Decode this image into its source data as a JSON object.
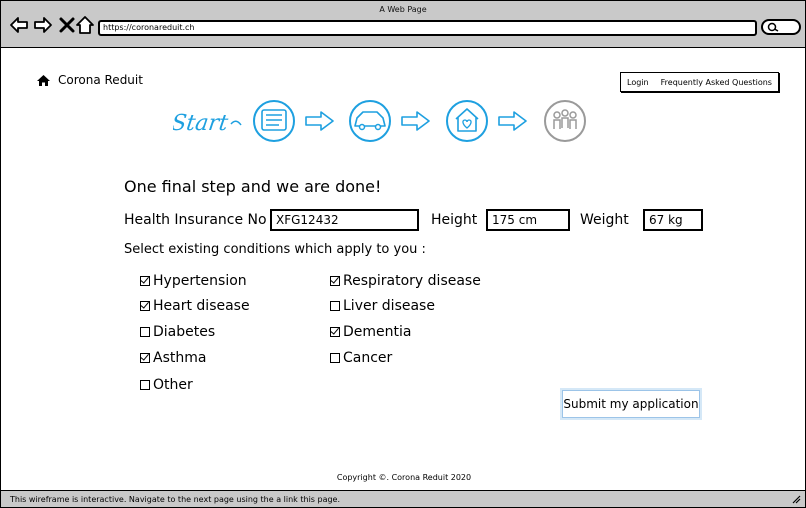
{
  "browser": {
    "title": "A Web Page",
    "url": "https://coronareduit.ch"
  },
  "site": {
    "brand": "Corona Reduit",
    "nav": {
      "login": "Login",
      "faq": "Frequently Asked Questions"
    },
    "steps_start": "Start"
  },
  "form": {
    "heading": "One final step and we are done!",
    "insurance_label": "Health Insurance No",
    "insurance_value": "XFG12432",
    "height_label": "Height",
    "height_value": "175 cm",
    "weight_label": "Weight",
    "weight_value": "67 kg",
    "conditions_prompt": "Select existing conditions which apply to you :",
    "conditions": [
      {
        "label": "Hypertension",
        "checked": true
      },
      {
        "label": "Respiratory disease",
        "checked": true
      },
      {
        "label": "Heart disease",
        "checked": true
      },
      {
        "label": "Liver disease",
        "checked": false
      },
      {
        "label": "Diabetes",
        "checked": false
      },
      {
        "label": "Dementia",
        "checked": true
      },
      {
        "label": "Asthma",
        "checked": true
      },
      {
        "label": "Cancer",
        "checked": false
      },
      {
        "label": "Other",
        "checked": false
      }
    ],
    "submit_label": "Submit my application"
  },
  "footer": {
    "copyright": "Copyright ©. Corona Reduit 2020"
  },
  "status": {
    "text": "This wireframe is interactive. Navigate to the next page using the a link this page."
  },
  "colors": {
    "accent": "#1ea0e0",
    "inactive": "#9a9a9a",
    "chrome": "#c9c9c9"
  }
}
